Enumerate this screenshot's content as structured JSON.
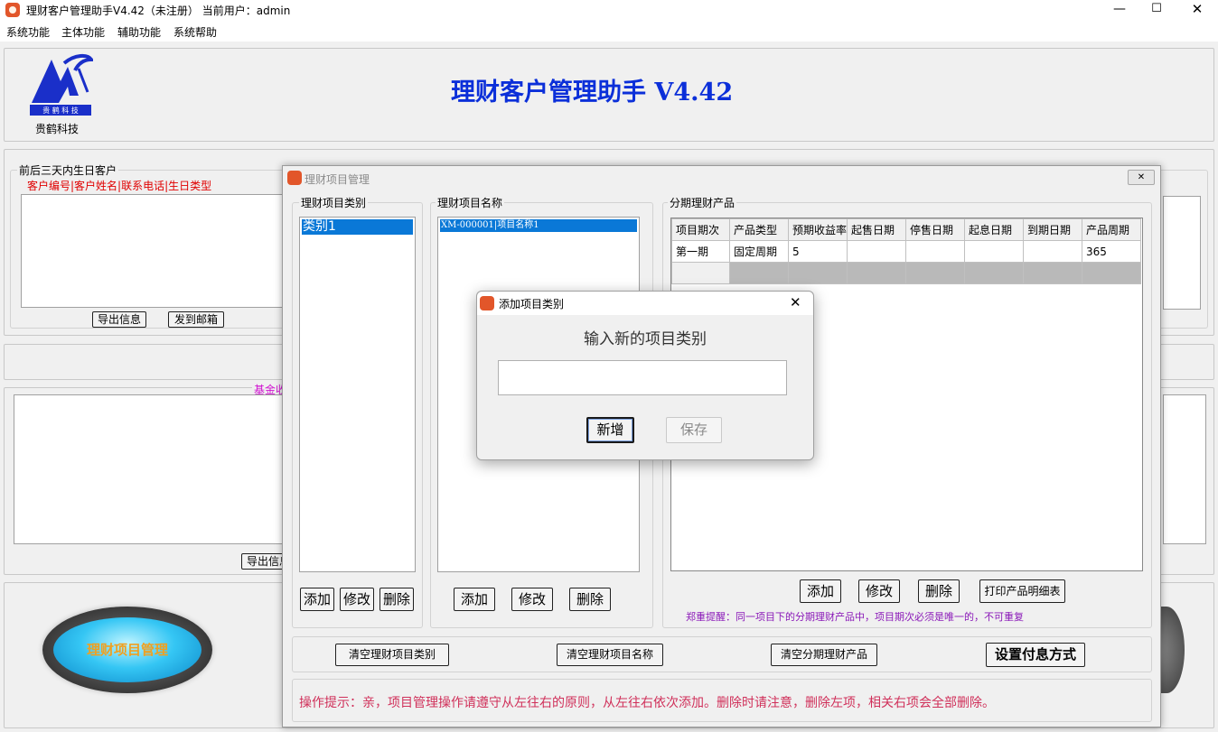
{
  "window": {
    "title": "理财客户管理助手V4.42（未注册）  当前用户：admin",
    "min": "—",
    "max": "☐",
    "close": "✕"
  },
  "menu": [
    "系统功能",
    "主体功能",
    "辅助功能",
    "系统帮助"
  ],
  "header": {
    "company": "贵鹤科技",
    "logo_text": "贵 鹤 科 技",
    "app_title": "理财客户管理助手 V4.42"
  },
  "birthday_panel": {
    "title": "前后三天内生日客户",
    "columns": "客户编号|客户姓名|联系电话|生日类型",
    "export_btn": "导出信息",
    "email_btn": "发到邮箱"
  },
  "fund_panel": {
    "title": "基金收",
    "export_btn": "导出信息"
  },
  "big_button": {
    "label": "理财项目管理"
  },
  "project_window": {
    "title": "理财项目管理",
    "close": "✕",
    "category_group": {
      "title": "理财项目类别",
      "items": [
        "类别1"
      ],
      "add": "添加",
      "edit": "修改",
      "delete": "删除"
    },
    "name_group": {
      "title": "理财项目名称",
      "items": [
        "XM-000001|项目名称1"
      ],
      "add": "添加",
      "edit": "修改",
      "delete": "删除"
    },
    "product_group": {
      "title": "分期理财产品",
      "columns": [
        "项目期次",
        "产品类型",
        "预期收益率",
        "起售日期",
        "停售日期",
        "起息日期",
        "到期日期",
        "产品周期"
      ],
      "rows": [
        [
          "第一期",
          "固定周期",
          "5",
          "",
          "",
          "",
          "",
          "365"
        ]
      ],
      "add": "添加",
      "edit": "修改",
      "delete": "删除",
      "print": "打印产品明细表",
      "notice": "郑重提醒：同一项目下的分期理财产品中，项目期次必须是唯一的，不可重复"
    },
    "clear_category": "清空理财项目类别",
    "clear_name": "清空理财项目名称",
    "clear_product": "清空分期理财产品",
    "set_payment": "设置付息方式",
    "tip": "操作提示：亲，项目管理操作请遵守从左往右的原则，从左往右依次添加。删除时请注意，删除左项，相关右项会全部删除。"
  },
  "dialog": {
    "title": "添加项目类别",
    "close": "✕",
    "prompt": "输入新的项目类别",
    "input_value": "",
    "new_btn": "新增",
    "save_btn": "保存"
  },
  "colors": {
    "accent_blue": "#0b2fd9",
    "red": "#e00000",
    "magenta": "#d010d0",
    "tip": "#d0305a",
    "purple_notice": "#8a18b8",
    "selection": "#0a78d7"
  }
}
